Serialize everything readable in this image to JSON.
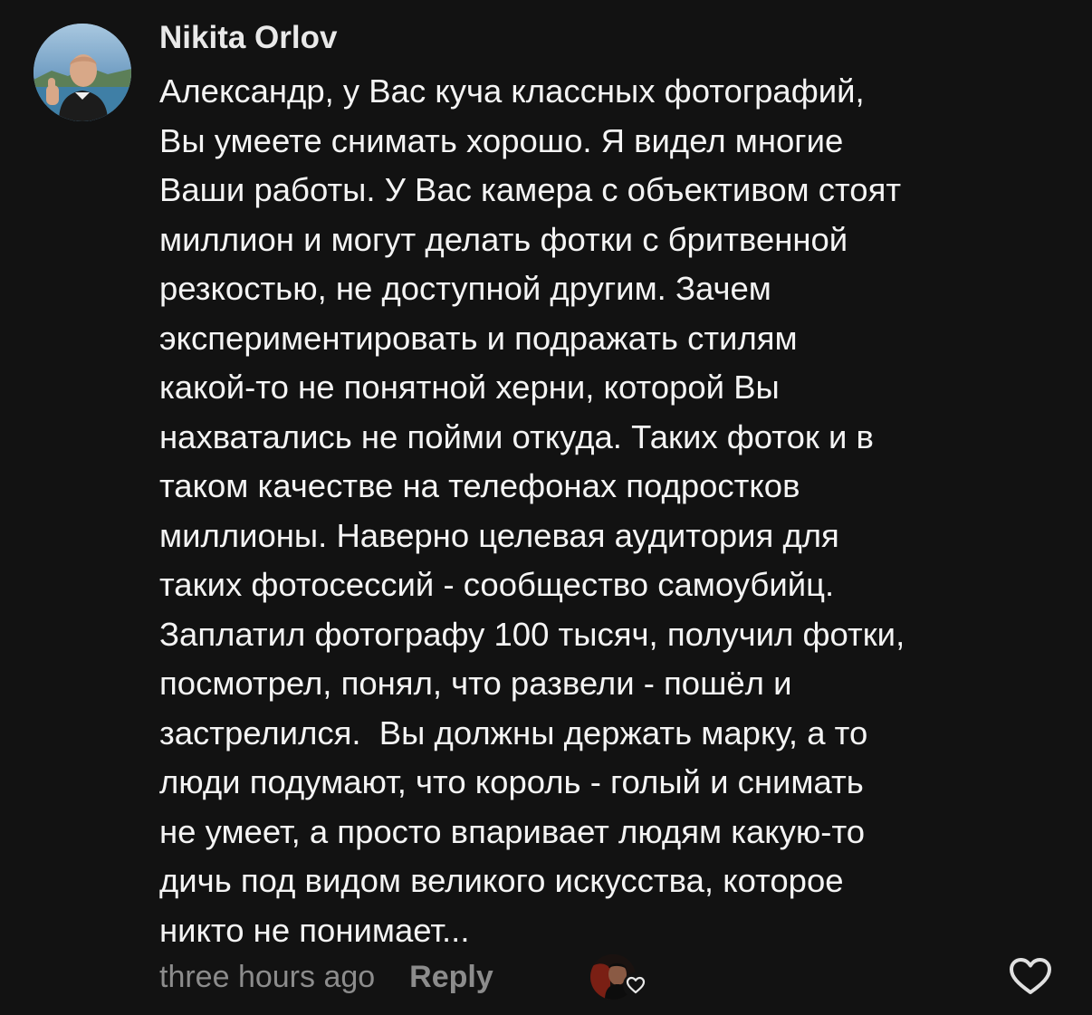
{
  "comment": {
    "author": "Nikita Orlov",
    "avatar_icon": "user-avatar-photo",
    "text_lines": [
      "Александр, у Вас куча классных фотографий,",
      "Вы умеете снимать хорошо. Я видел многие",
      "Ваши работы. У Вас камера с объективом стоят",
      "миллион и могут делать фотки с бритвенной",
      "резкостью, не доступной другим. Зачем",
      "экспериментировать и подражать стилям",
      "какой-то не понятной херни, которой Вы",
      "нахватались не пойми откуда. Таких фоток и в",
      "таком качестве на телефонах подростков",
      "миллионы. Наверно целевая аудитория для",
      "таких фотосессий - сообщество самоубийц.",
      "Заплатил фотографу 100 тысяч, получил фотки,",
      "посмотрел, понял, что развели - пошёл и",
      "застрелился.  Вы должны держать марку, а то",
      "люди подумают, что король - голый и снимать",
      "не умеет, а просто впаривает людям какую-то",
      "дичь под видом великого искусства, которое",
      "никто не понимает..."
    ],
    "timestamp": "three hours ago",
    "reply_label": "Reply",
    "liked_by_icon": "creator-liked-avatar",
    "like_icon": "heart-outline-icon"
  },
  "colors": {
    "background": "#121212",
    "text": "#f4f4f4",
    "muted": "#8c8c8c"
  }
}
